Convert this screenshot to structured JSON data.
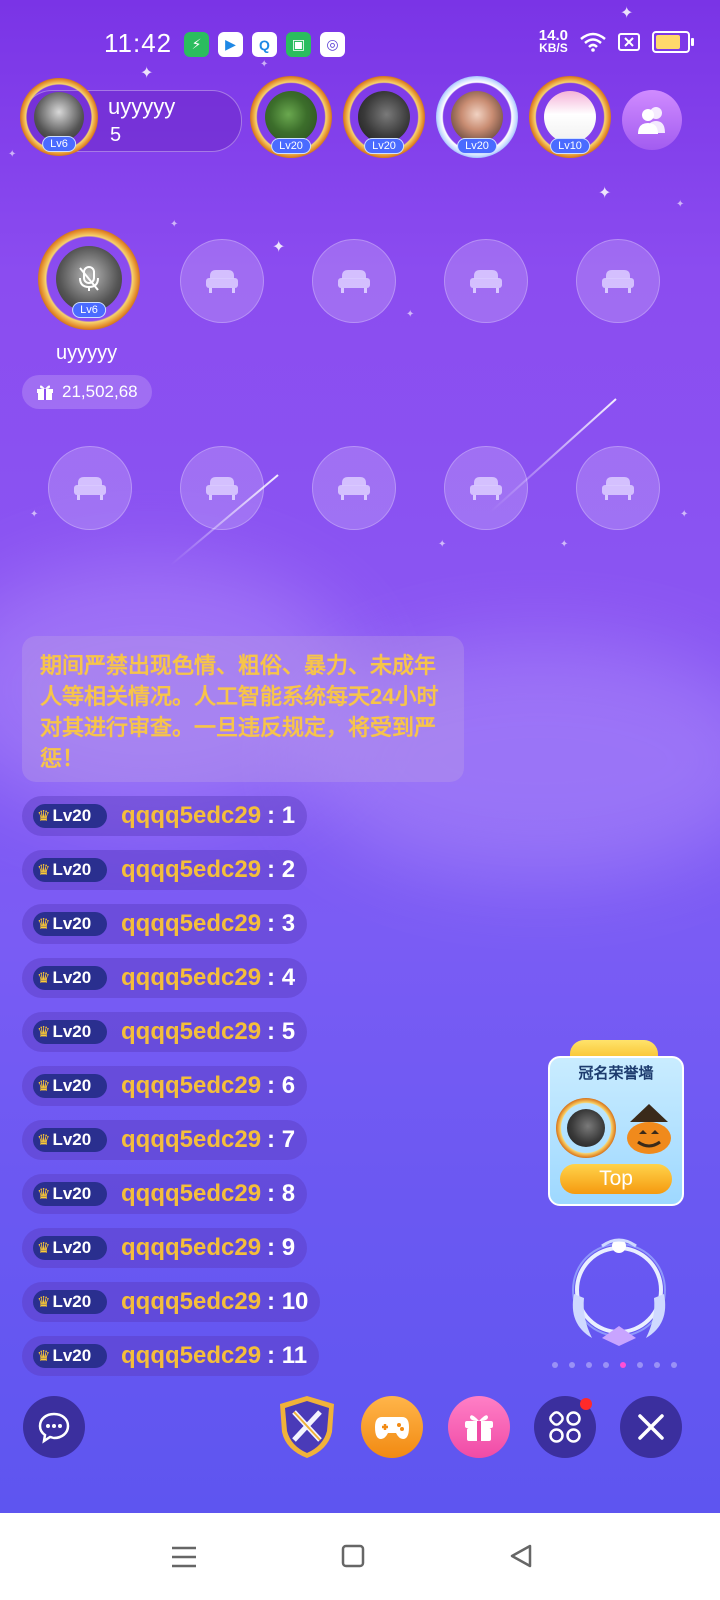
{
  "status_bar": {
    "time": "11:42",
    "net_speed_value": "14.0",
    "net_speed_unit": "KB/S"
  },
  "host": {
    "name": "uyyyyy",
    "number": "5",
    "level": "Lv6"
  },
  "rank": [
    {
      "level": "Lv20"
    },
    {
      "level": "Lv20"
    },
    {
      "level": "Lv20"
    },
    {
      "level": "Lv10"
    }
  ],
  "host_seat": {
    "name": "uyyyyy",
    "level": "Lv6",
    "gift_value": "21,502,68"
  },
  "notice": {
    "text": "期间严禁出现色情、粗俗、暴力、未成年人等相关情况。人工智能系统每天24小时对其进行审查。一旦违反规定，将受到严惩！"
  },
  "chat": [
    {
      "level": "Lv20",
      "name": "qqqq5edc29",
      "message": ": 1"
    },
    {
      "level": "Lv20",
      "name": "qqqq5edc29",
      "message": ": 2"
    },
    {
      "level": "Lv20",
      "name": "qqqq5edc29",
      "message": ": 3"
    },
    {
      "level": "Lv20",
      "name": "qqqq5edc29",
      "message": ": 4"
    },
    {
      "level": "Lv20",
      "name": "qqqq5edc29",
      "message": ": 5"
    },
    {
      "level": "Lv20",
      "name": "qqqq5edc29",
      "message": ": 6"
    },
    {
      "level": "Lv20",
      "name": "qqqq5edc29",
      "message": ": 7"
    },
    {
      "level": "Lv20",
      "name": "qqqq5edc29",
      "message": ": 8"
    },
    {
      "level": "Lv20",
      "name": "qqqq5edc29",
      "message": ": 9"
    },
    {
      "level": "Lv20",
      "name": "qqqq5edc29",
      "message": ": 10"
    },
    {
      "level": "Lv20",
      "name": "qqqq5edc29",
      "message": ": 11"
    }
  ],
  "honor_wall": {
    "title": "冠名荣誉墙",
    "button": "Top"
  },
  "colors": {
    "accent_gold": "#f4be3b",
    "lv_badge": "#2a2f8f",
    "page_dot_active": "#ff4fd6"
  },
  "icons": {
    "seat": "sofa-icon",
    "chat": "chat-bubble-icon",
    "game": "gamepad-icon",
    "gift": "gift-icon",
    "more": "grid-icon",
    "close": "close-icon"
  }
}
